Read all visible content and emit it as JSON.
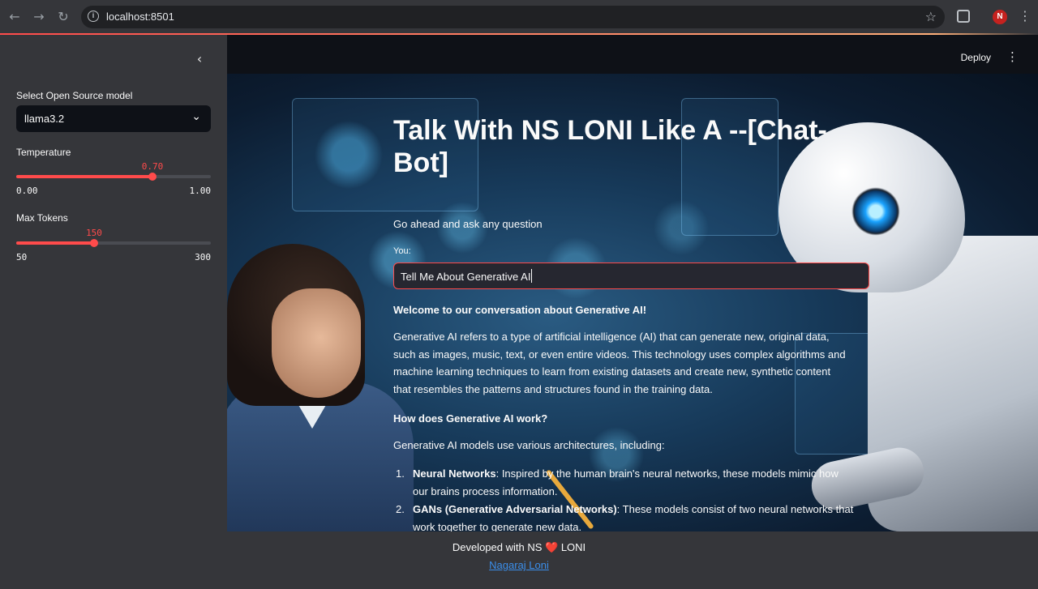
{
  "browser": {
    "url": "localhost:8501",
    "profile_initial": "N"
  },
  "sidebar": {
    "model_label": "Select Open Source model",
    "model_value": "llama3.2",
    "temperature": {
      "label": "Temperature",
      "value": "0.70",
      "min": "0.00",
      "max": "1.00",
      "fraction": 0.7
    },
    "max_tokens": {
      "label": "Max Tokens",
      "value": "150",
      "min": "50",
      "max": "300",
      "fraction": 0.4
    }
  },
  "header": {
    "deploy_label": "Deploy"
  },
  "main": {
    "title": "Talk With NS LONI Like A --[Chat-Bot]",
    "prompt": "Go ahead and ask any question",
    "input_label": "You:",
    "input_value": "Tell Me About Generative AI",
    "response": {
      "welcome": "Welcome to our conversation about Generative AI!",
      "intro": "Generative AI refers to a type of artificial intelligence (AI) that can generate new, original data, such as images, music, text, or even entire videos. This technology uses complex algorithms and machine learning techniques to learn from existing datasets and create new, synthetic content that resembles the patterns and structures found in the training data.",
      "how_heading": "How does Generative AI work?",
      "arch_intro": "Generative AI models use various architectures, including:",
      "items": [
        {
          "num": "1.",
          "title": "Neural Networks",
          "text": ": Inspired by the human brain's neural networks, these models mimic how our brains process information."
        },
        {
          "num": "2.",
          "title": "GANs (Generative Adversarial Networks)",
          "text": ": These models consist of two neural networks that work together to generate new data."
        }
      ]
    }
  },
  "footer": {
    "developed_prefix": "Developed with NS",
    "heart": "❤️",
    "developed_suffix": "LONI",
    "author_link": "Nagaraj Loni"
  },
  "colors": {
    "accent": "#ff4b4b",
    "link": "#3b8eea",
    "sidebar_bg": "#35363a",
    "app_bg": "#0e1117"
  }
}
